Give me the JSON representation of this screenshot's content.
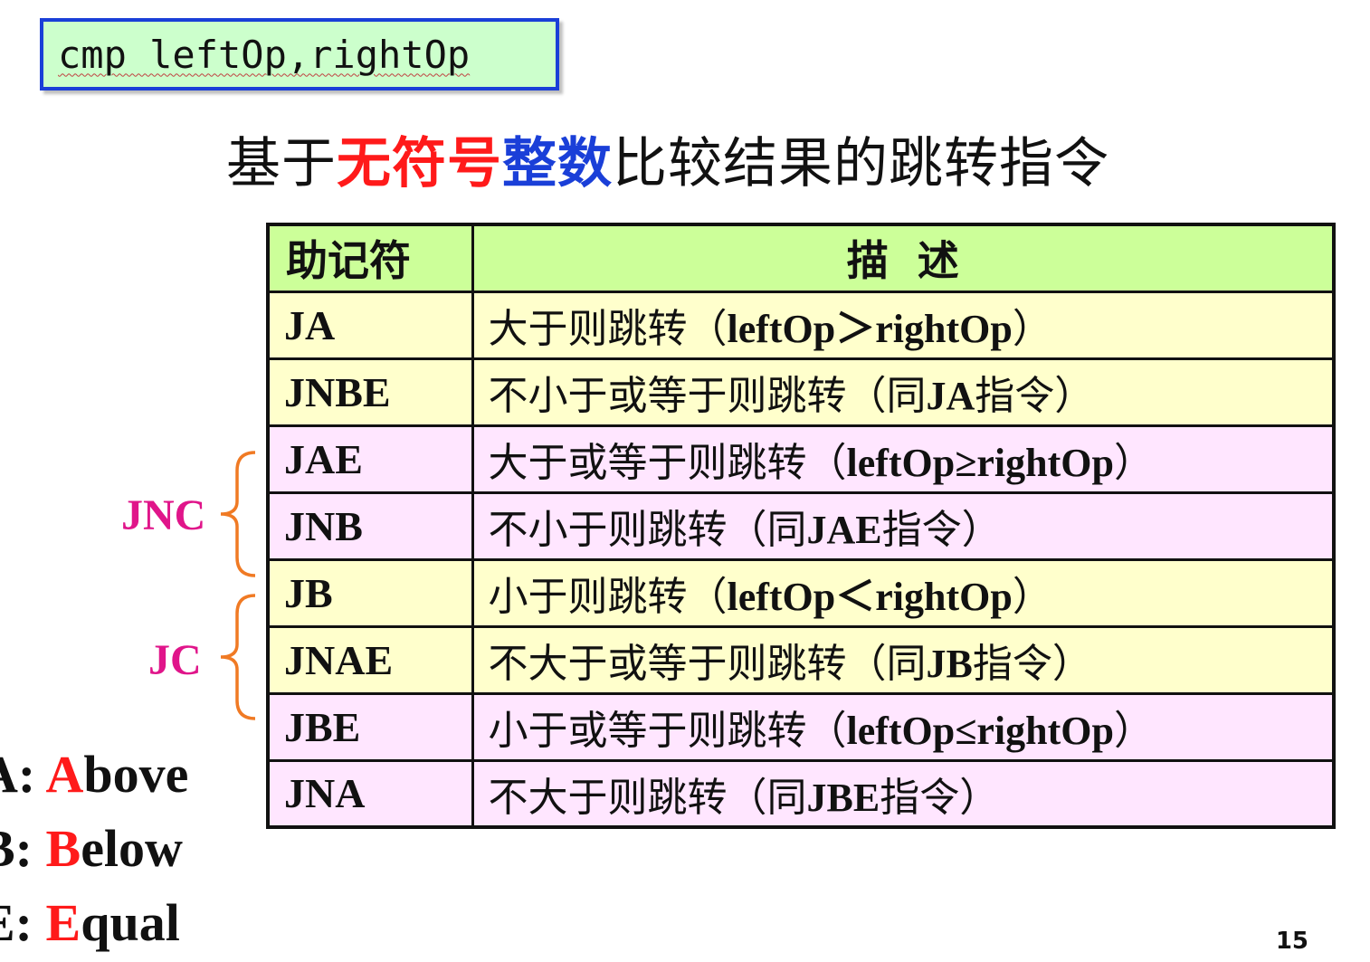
{
  "code_box": {
    "text": "cmp leftOp,rightOp"
  },
  "title": {
    "part1": "基于",
    "part2": "无符号",
    "part3": "整数",
    "part4": "比较结果的跳转指令"
  },
  "table": {
    "header": {
      "col1": "助记符",
      "col2": "描  述"
    },
    "rows": [
      {
        "mnemonic": "JA",
        "desc_pre": "大于则跳转（",
        "desc_b": "leftOp＞rightOp",
        "desc_post": "）"
      },
      {
        "mnemonic": "JNBE",
        "desc_pre": "不小于或等于则跳转（同",
        "desc_b": "JA",
        "desc_post": "指令）"
      },
      {
        "mnemonic": "JAE",
        "desc_pre": "大于或等于则跳转（",
        "desc_b": "leftOp≥rightOp",
        "desc_post": "）"
      },
      {
        "mnemonic": "JNB",
        "desc_pre": "不小于则跳转（同",
        "desc_b": "JAE",
        "desc_post": "指令）"
      },
      {
        "mnemonic": "JB",
        "desc_pre": "小于则跳转（",
        "desc_b": "leftOp＜rightOp",
        "desc_post": "）"
      },
      {
        "mnemonic": "JNAE",
        "desc_pre": "不大于或等于则跳转（同",
        "desc_b": "JB",
        "desc_post": "指令）"
      },
      {
        "mnemonic": "JBE",
        "desc_pre": "小于或等于则跳转（",
        "desc_b": "leftOp≤rightOp",
        "desc_post": "）"
      },
      {
        "mnemonic": "JNA",
        "desc_pre": "不大于则跳转（同",
        "desc_b": "JBE",
        "desc_post": "指令）"
      }
    ]
  },
  "groups": {
    "jnc": "JNC",
    "jc": "JC"
  },
  "legend": [
    {
      "prefix": "A: ",
      "letter": "A",
      "rest": "bove"
    },
    {
      "prefix": "B: ",
      "letter": "B",
      "rest": "elow"
    },
    {
      "prefix": "E: ",
      "letter": "E",
      "rest": "qual"
    }
  ],
  "page_number": "15",
  "colors": {
    "code_bg": "#ccffcc",
    "code_border": "#1a3fd8",
    "red": "#ff1a1a",
    "blue": "#1a3fd8",
    "header_bg": "#ccff99",
    "row_yellow": "#ffffcc",
    "row_pink": "#ffe6ff",
    "group_label": "#e0158a",
    "brace": "#f07a24"
  }
}
